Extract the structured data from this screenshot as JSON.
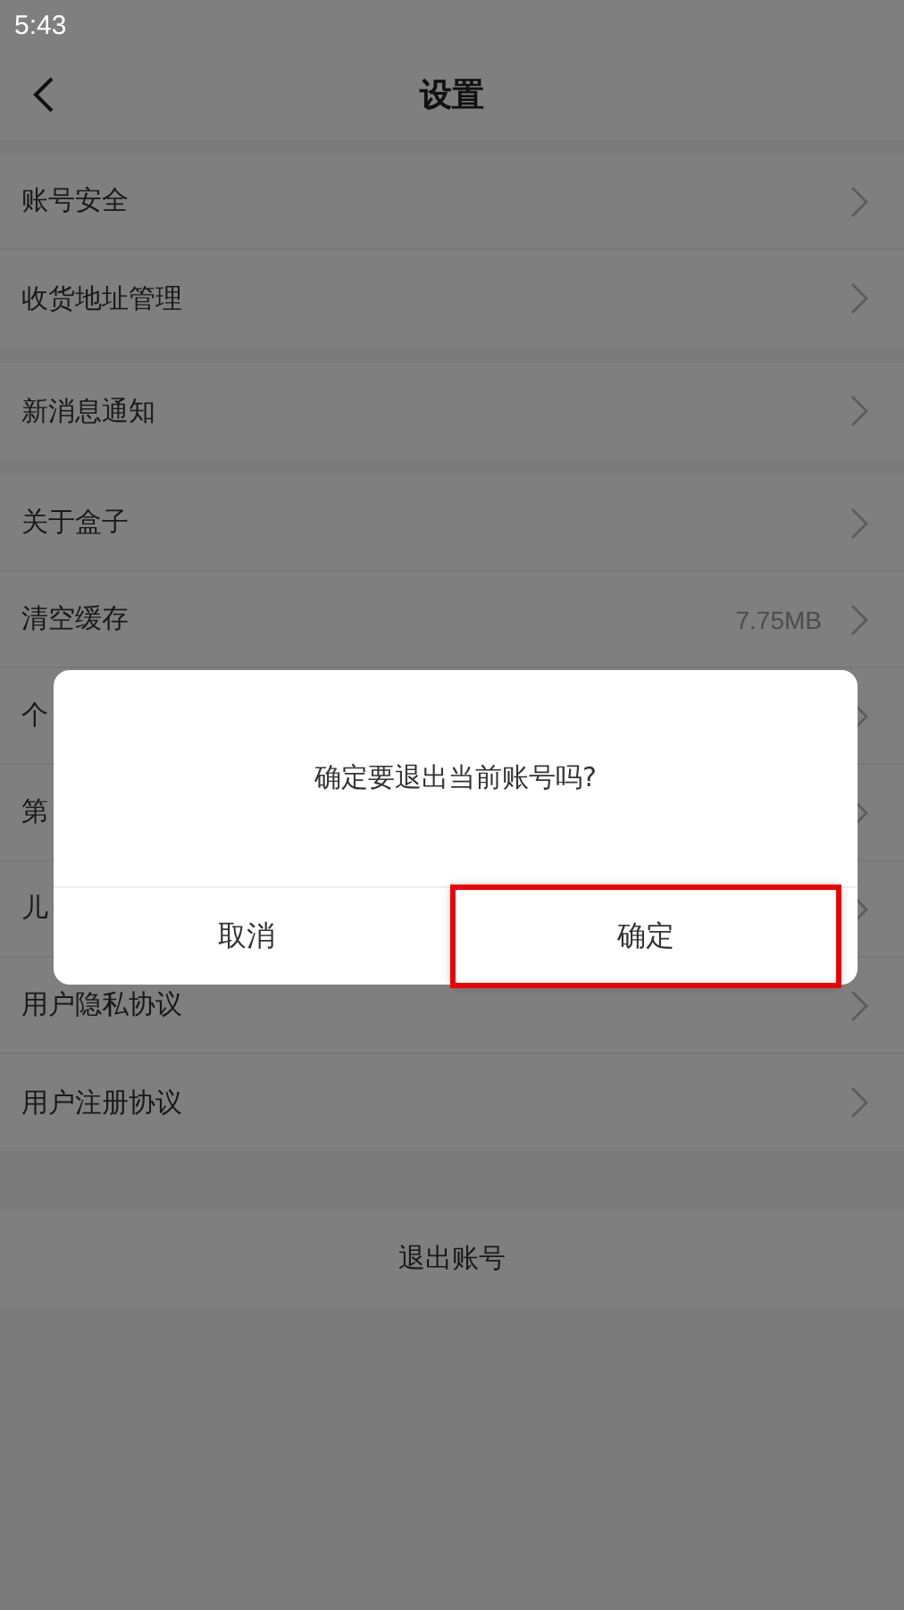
{
  "status_bar": {
    "time": "5:43"
  },
  "header": {
    "title": "设置"
  },
  "groups": [
    {
      "items": [
        {
          "label": "账号安全"
        },
        {
          "label": "收货地址管理"
        }
      ]
    },
    {
      "items": [
        {
          "label": "新消息通知"
        }
      ]
    },
    {
      "items": [
        {
          "label": "关于盒子"
        },
        {
          "label": "清空缓存",
          "value": "7.75MB"
        },
        {
          "label": "个"
        },
        {
          "label": "第"
        },
        {
          "label": "儿"
        },
        {
          "label": "用户隐私协议"
        },
        {
          "label": "用户注册协议"
        }
      ]
    }
  ],
  "logout_button": "退出账号",
  "dialog": {
    "message": "确定要退出当前账号吗?",
    "buttons": [
      {
        "label": "取消",
        "highlighted": false
      },
      {
        "label": "确定",
        "highlighted": true
      }
    ]
  }
}
